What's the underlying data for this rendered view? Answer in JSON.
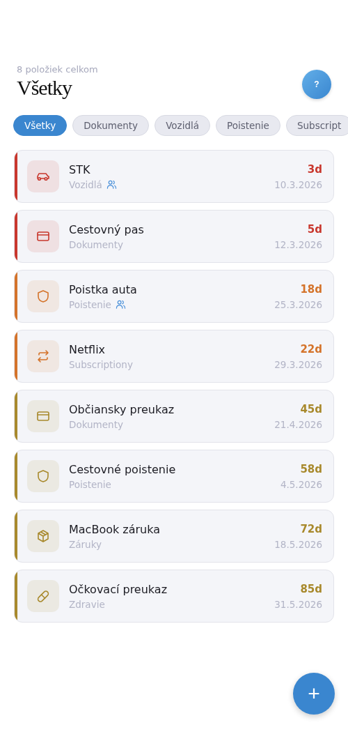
{
  "header": {
    "subtitle": "8 položiek celkom",
    "title": "Všetky",
    "help_button": "?"
  },
  "filters": [
    {
      "label": "Všetky",
      "selected": true
    },
    {
      "label": "Dokumenty",
      "selected": false
    },
    {
      "label": "Vozidlá",
      "selected": false
    },
    {
      "label": "Poistenie",
      "selected": false
    },
    {
      "label": "Subscript",
      "selected": false
    }
  ],
  "items": [
    {
      "name": "STK",
      "category": "Vozidlá",
      "shared": true,
      "kind": "car",
      "days": "3d",
      "date": "10.3.2026",
      "color": "#c8372d"
    },
    {
      "name": "Cestovný pas",
      "category": "Dokumenty",
      "shared": false,
      "kind": "card",
      "days": "5d",
      "date": "12.3.2026",
      "color": "#c8372d"
    },
    {
      "name": "Poistka auta",
      "category": "Poistenie",
      "shared": true,
      "kind": "shield",
      "days": "18d",
      "date": "25.3.2026",
      "color": "#d4732a"
    },
    {
      "name": "Netflix",
      "category": "Subscriptiony",
      "shared": false,
      "kind": "repeat",
      "days": "22d",
      "date": "29.3.2026",
      "color": "#d4732a"
    },
    {
      "name": "Občiansky preukaz",
      "category": "Dokumenty",
      "shared": false,
      "kind": "card",
      "days": "45d",
      "date": "21.4.2026",
      "color": "#a8892c"
    },
    {
      "name": "Cestovné poistenie",
      "category": "Poistenie",
      "shared": false,
      "kind": "shield",
      "days": "58d",
      "date": "4.5.2026",
      "color": "#a8892c"
    },
    {
      "name": "MacBook záruka",
      "category": "Záruky",
      "shared": false,
      "kind": "box",
      "days": "72d",
      "date": "18.5.2026",
      "color": "#a8892c"
    },
    {
      "name": "Očkovací preukaz",
      "category": "Zdravie",
      "shared": false,
      "kind": "pill",
      "days": "85d",
      "date": "31.5.2026",
      "color": "#a8892c"
    }
  ],
  "fab": "+"
}
